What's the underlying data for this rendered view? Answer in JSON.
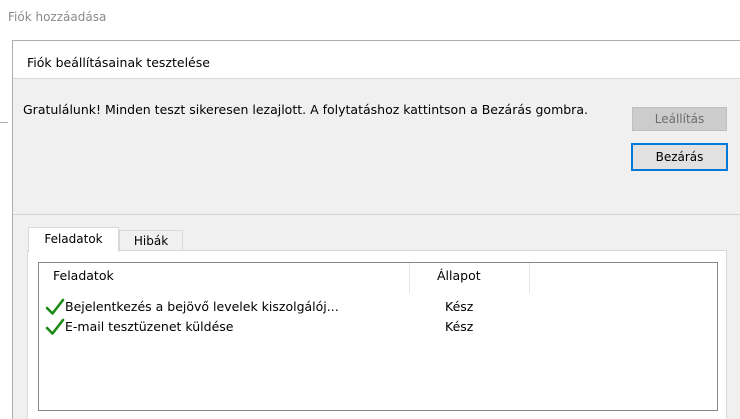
{
  "background": {
    "window_title": "Fiók hozzáadása"
  },
  "dialog": {
    "title": "Fiók beállításainak tesztelése",
    "message": "Gratulálunk! Minden teszt sikeresen lezajlott. A folytatáshoz kattintson a Bezárás gombra.",
    "stop_button": "Leállítás",
    "close_button": "Bezárás",
    "tabs": [
      {
        "label": "Feladatok",
        "active": true
      },
      {
        "label": "Hibák",
        "active": false
      }
    ],
    "table": {
      "columns": [
        "Feladatok",
        "Állapot"
      ],
      "rows": [
        {
          "task": "Bejelentkezés a bejövő levelek kiszolgálój...",
          "status": "Kész",
          "icon": "checkmark-icon"
        },
        {
          "task": "E-mail tesztüzenet küldése",
          "status": "Kész",
          "icon": "checkmark-icon"
        }
      ]
    }
  },
  "colors": {
    "accent": "#0078d7",
    "check": "#1a8a17",
    "dialog_bg": "#f0f0f0"
  }
}
